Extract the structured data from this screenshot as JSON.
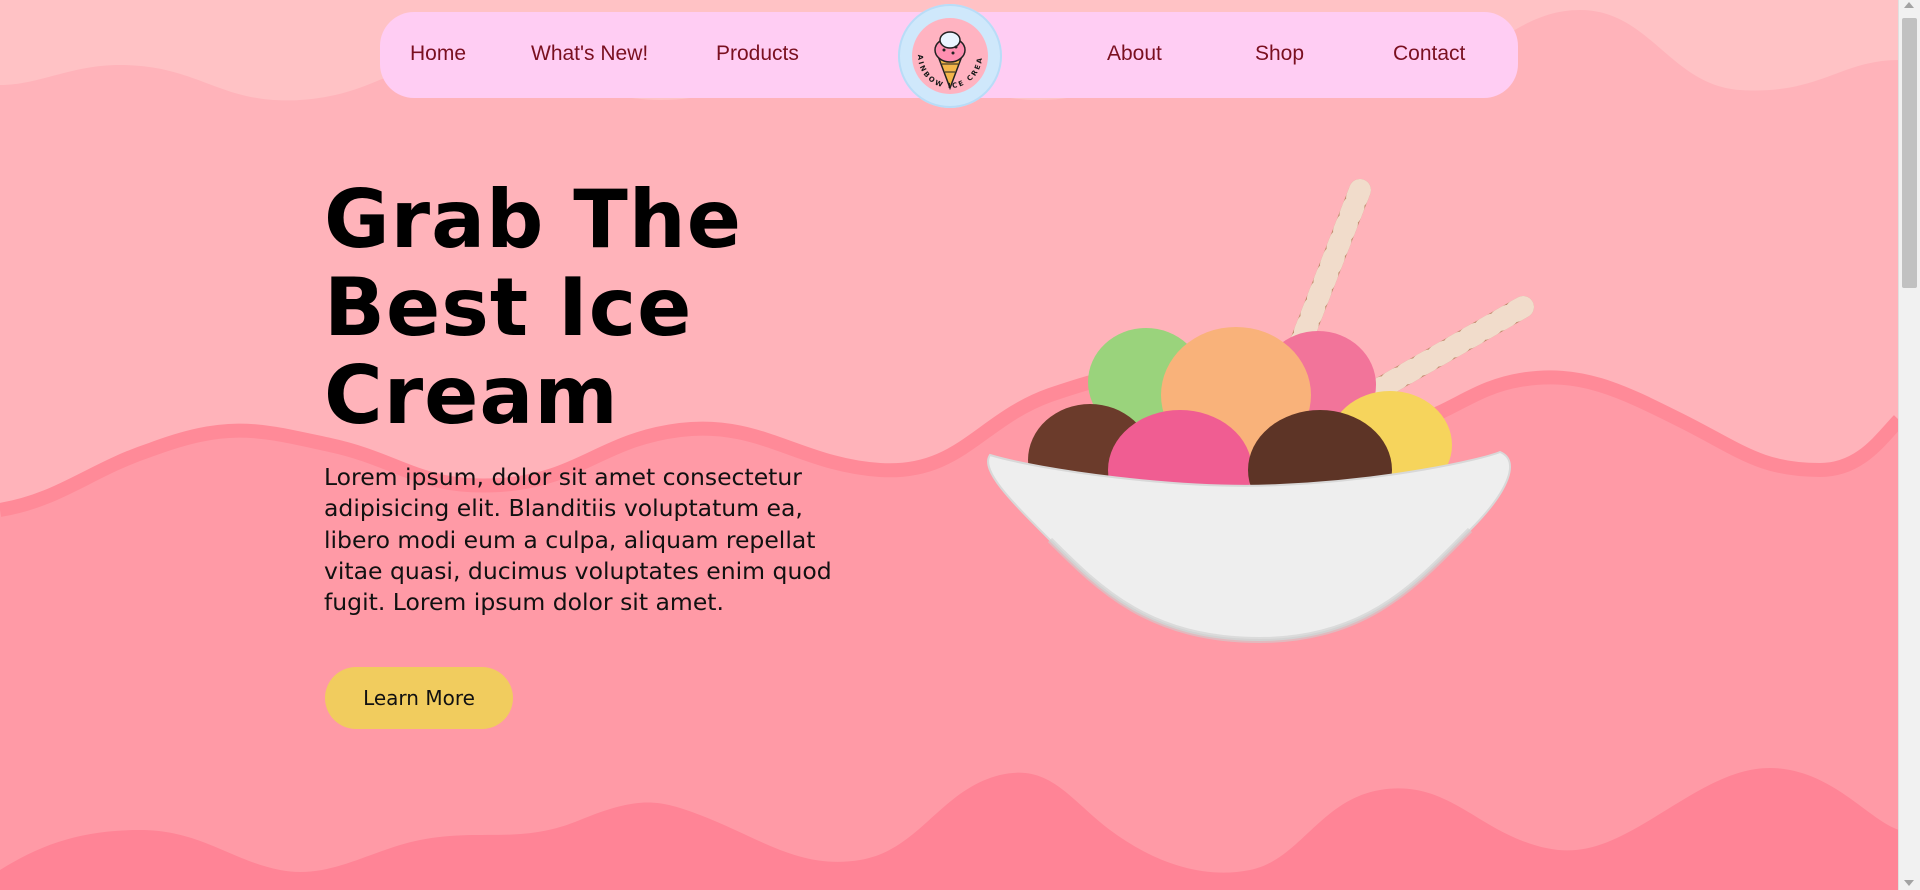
{
  "nav": {
    "items": [
      {
        "label": "Home"
      },
      {
        "label": "What's New!"
      },
      {
        "label": "Products"
      },
      {
        "label": "About"
      },
      {
        "label": "Shop"
      },
      {
        "label": "Contact"
      }
    ],
    "logo_text": "RAINBOW ICE CREAM"
  },
  "hero": {
    "title": "Grab The Best Ice Cream",
    "description": "Lorem ipsum, dolor sit amet consectetur adipisicing elit. Blanditiis voluptatum ea, libero modi eum a culpa, aliquam repellat vitae quasi, ducimus voluptates enim quod fugit. Lorem ipsum dolor sit amet.",
    "cta_label": "Learn More"
  },
  "colors": {
    "background": "#ffb3ba",
    "wave_mid": "#ff9aa6",
    "wave_deep": "#ff8496",
    "navbar": "#ffcdf3",
    "nav_text": "#7a1020",
    "button": "#f1cc5e"
  },
  "icons": [
    "ice-cream-cone-icon",
    "scroll-up-arrow-icon",
    "scroll-down-arrow-icon"
  ]
}
